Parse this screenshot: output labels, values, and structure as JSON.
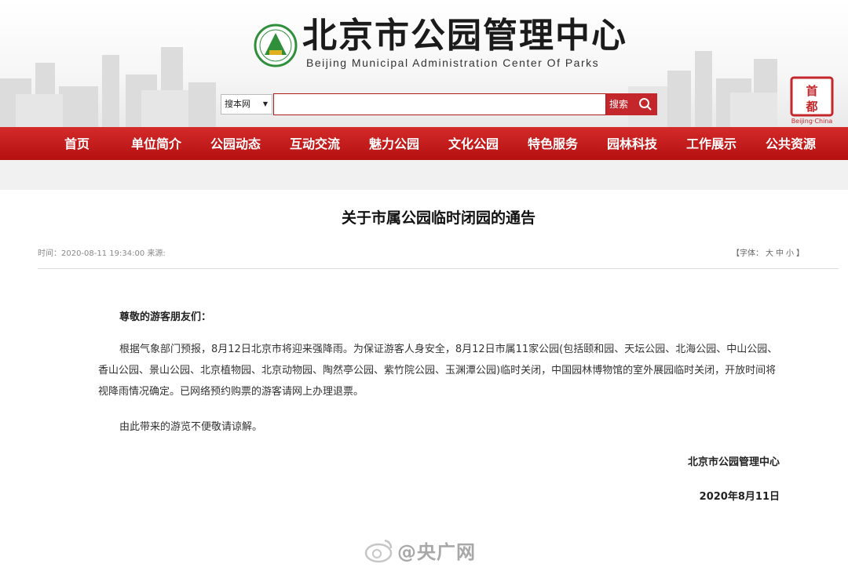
{
  "header": {
    "title": "北京市公园管理中心",
    "subtitle": "Beijing Municipal Administration Center Of Parks",
    "search_scope": "搜本网",
    "search_button": "搜索",
    "badge_text": "首都",
    "badge_caption": "Beijing·China"
  },
  "nav": {
    "items": [
      "首页",
      "单位简介",
      "公园动态",
      "互动交流",
      "魅力公园",
      "文化公园",
      "特色服务",
      "园林科技",
      "工作展示",
      "公共资源"
    ]
  },
  "article": {
    "title": "关于市属公园临时闭园的通告",
    "meta": "时间：2020-08-11 19:34:00 来源:",
    "fontsize_label": "【字体：",
    "fontsize_options": [
      "大",
      "中",
      "小"
    ],
    "fontsize_close": "】",
    "greeting": "尊敬的游客朋友们：",
    "paragraph1": "根据气象部门预报，8月12日北京市将迎来强降雨。为保证游客人身安全，8月12日市属11家公园(包括颐和园、天坛公园、北海公园、中山公园、香山公园、景山公园、北京植物园、北京动物园、陶然亭公园、紫竹院公园、玉渊潭公园)临时关闭，中国园林博物馆的室外展园临时关闭，开放时间将视降雨情况确定。已网络预约购票的游客请网上办理退票。",
    "paragraph2": "由此带来的游览不便敬请谅解。",
    "signature": "北京市公园管理中心",
    "date": "2020年8月11日"
  },
  "watermark": "@央广网",
  "colors": {
    "nav_red": "#c3272b",
    "accent_green": "#2f8f3a"
  }
}
